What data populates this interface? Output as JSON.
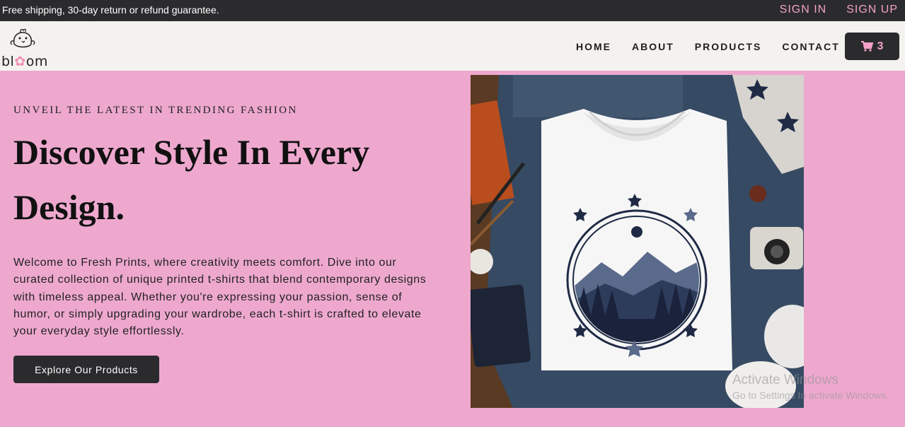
{
  "topbar": {
    "promo": "Free shipping, 30-day return or refund guarantee.",
    "sign_in": "SIGN IN",
    "sign_up": "SIGN UP"
  },
  "brand": {
    "name_start": "bl",
    "name_flower": "✿",
    "name_end": "om"
  },
  "nav": {
    "items": [
      "HOME",
      "ABOUT",
      "PRODUCTS",
      "CONTACT"
    ]
  },
  "cart": {
    "icon": "cart-icon",
    "count": "3"
  },
  "hero": {
    "eyebrow": "UNVEIL THE LATEST IN TRENDING FASHION",
    "headline": "Discover Style In Every Design.",
    "description": "Welcome to Fresh Prints, where creativity meets comfort. Dive into our curated collection of unique printed t-shirts that blend contemporary designs with timeless appeal. Whether you're expressing your passion, sense of humor, or simply upgrading your wardrobe, each t-shirt is crafted to elevate your everyday style effortlessly.",
    "cta": "Explore Our Products"
  },
  "watermark": {
    "line1": "Activate Windows",
    "line2": "Go to Settings to activate Windows."
  },
  "colors": {
    "accent_pink": "#f3a1c8",
    "hero_bg": "#eea8ce",
    "dark": "#2b2b2e"
  }
}
